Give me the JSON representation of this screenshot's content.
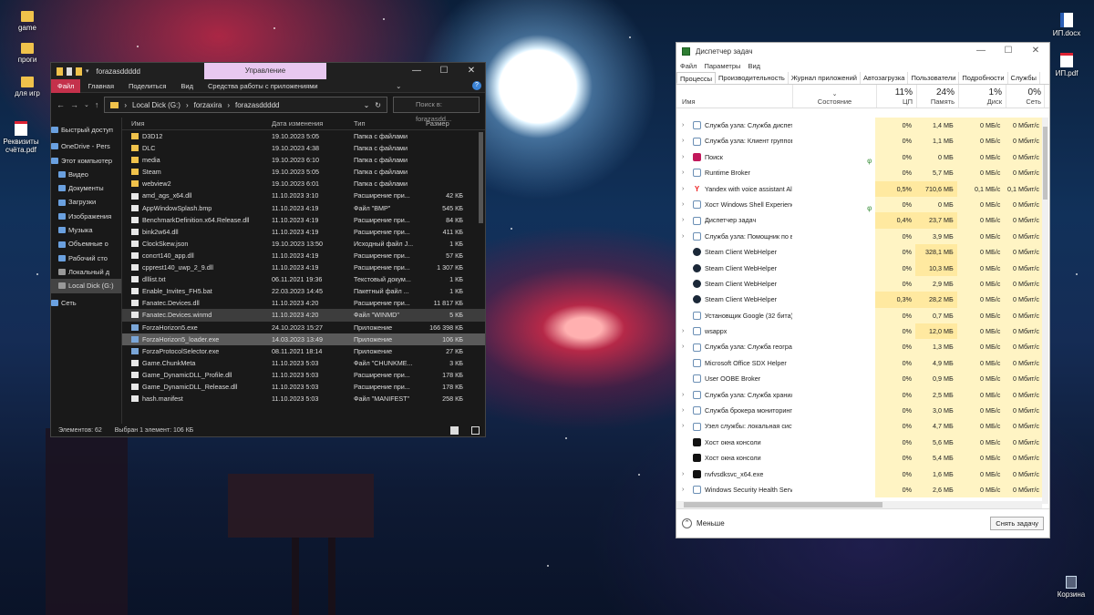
{
  "desktop": {
    "left_icons": [
      {
        "label": "game",
        "icon": "folder-icon"
      },
      {
        "label": "проги",
        "icon": "folder-icon"
      },
      {
        "label": "для игр",
        "icon": "folder-icon"
      },
      {
        "label": "Реквизиты счёта.pdf",
        "icon": "pdf-icon"
      }
    ],
    "right_icons": [
      {
        "label": "ИП.docx",
        "icon": "word-icon"
      },
      {
        "label": "ИП.pdf",
        "icon": "pdf-icon"
      }
    ],
    "recycle_bin": "Корзина"
  },
  "explorer": {
    "title": "forazasddddd",
    "context_tab": "Управление",
    "ribbon": [
      "Файл",
      "Главная",
      "Поделиться",
      "Вид",
      "Средства работы с приложениями"
    ],
    "path": [
      "Local Dick (G:)",
      "forzaxira",
      "forazasddddd"
    ],
    "search_placeholder": "Поиск в: forazasdd...",
    "sidebar": [
      "Быстрый доступ",
      "OneDrive - Pers",
      "Этот компьютер",
      "Видео",
      "Документы",
      "Загрузки",
      "Изображения",
      "Музыка",
      "Объемные о",
      "Рабочий сто",
      "Локальный д",
      "Local Dick (G:)",
      "Сеть"
    ],
    "columns": [
      "Имя",
      "Дата изменения",
      "Тип",
      "Размер"
    ],
    "files": [
      {
        "name": "D3D12",
        "date": "19.10.2023 5:05",
        "type": "Папка с файлами",
        "size": "",
        "kind": "folder"
      },
      {
        "name": "DLC",
        "date": "19.10.2023 4:38",
        "type": "Папка с файлами",
        "size": "",
        "kind": "folder"
      },
      {
        "name": "media",
        "date": "19.10.2023 6:10",
        "type": "Папка с файлами",
        "size": "",
        "kind": "folder"
      },
      {
        "name": "Steam",
        "date": "19.10.2023 5:05",
        "type": "Папка с файлами",
        "size": "",
        "kind": "folder"
      },
      {
        "name": "webview2",
        "date": "19.10.2023 6:01",
        "type": "Папка с файлами",
        "size": "",
        "kind": "folder"
      },
      {
        "name": "amd_ags_x64.dll",
        "date": "11.10.2023 3:10",
        "type": "Расширение при...",
        "size": "42 КБ",
        "kind": "file"
      },
      {
        "name": "AppWindowSplash.bmp",
        "date": "11.10.2023 4:19",
        "type": "Файл \"BMP\"",
        "size": "545 КБ",
        "kind": "file"
      },
      {
        "name": "BenchmarkDefinition.x64.Release.dll",
        "date": "11.10.2023 4:19",
        "type": "Расширение при...",
        "size": "84 КБ",
        "kind": "file"
      },
      {
        "name": "bink2w64.dll",
        "date": "11.10.2023 4:19",
        "type": "Расширение при...",
        "size": "411 КБ",
        "kind": "file"
      },
      {
        "name": "ClockSkew.json",
        "date": "19.10.2023 13:50",
        "type": "Исходный файл J...",
        "size": "1 КБ",
        "kind": "file"
      },
      {
        "name": "concrt140_app.dll",
        "date": "11.10.2023 4:19",
        "type": "Расширение при...",
        "size": "57 КБ",
        "kind": "file"
      },
      {
        "name": "cpprest140_uwp_2_9.dll",
        "date": "11.10.2023 4:19",
        "type": "Расширение при...",
        "size": "1 307 КБ",
        "kind": "file"
      },
      {
        "name": "dlllist.txt",
        "date": "06.11.2021 19:36",
        "type": "Текстовый докум...",
        "size": "1 КБ",
        "kind": "file"
      },
      {
        "name": "Enable_Invites_FH5.bat",
        "date": "22.03.2023 14:45",
        "type": "Пакетный файл ...",
        "size": "1 КБ",
        "kind": "file"
      },
      {
        "name": "Fanatec.Devices.dll",
        "date": "11.10.2023 4:20",
        "type": "Расширение при...",
        "size": "11 817 КБ",
        "kind": "file"
      },
      {
        "name": "Fanatec.Devices.winmd",
        "date": "11.10.2023 4:20",
        "type": "Файл \"WINMD\"",
        "size": "5 КБ",
        "kind": "file",
        "state": "hover"
      },
      {
        "name": "ForzaHorizon5.exe",
        "date": "24.10.2023 15:27",
        "type": "Приложение",
        "size": "166 398 КБ",
        "kind": "exe"
      },
      {
        "name": "ForzaHorizon5_loader.exe",
        "date": "14.03.2023 13:49",
        "type": "Приложение",
        "size": "106 КБ",
        "kind": "exe",
        "state": "selected"
      },
      {
        "name": "ForzaProtocolSelector.exe",
        "date": "08.11.2021 18:14",
        "type": "Приложение",
        "size": "27 КБ",
        "kind": "exe"
      },
      {
        "name": "Game.ChunkMeta",
        "date": "11.10.2023 5:03",
        "type": "Файл \"CHUNKME...",
        "size": "3 КБ",
        "kind": "file"
      },
      {
        "name": "Game_DynamicDLL_Profile.dll",
        "date": "11.10.2023 5:03",
        "type": "Расширение при...",
        "size": "178 КБ",
        "kind": "file"
      },
      {
        "name": "Game_DynamicDLL_Release.dll",
        "date": "11.10.2023 5:03",
        "type": "Расширение при...",
        "size": "178 КБ",
        "kind": "file"
      },
      {
        "name": "hash.manifest",
        "date": "11.10.2023 5:03",
        "type": "Файл \"MANIFEST\"",
        "size": "258 КБ",
        "kind": "file"
      }
    ],
    "status_count": "Элементов: 62",
    "status_selected": "Выбран 1 элемент: 106 КБ"
  },
  "taskmgr": {
    "title": "Диспетчер задач",
    "menu": [
      "Файл",
      "Параметры",
      "Вид"
    ],
    "tabs": [
      "Процессы",
      "Производительность",
      "Журнал приложений",
      "Автозагрузка",
      "Пользователи",
      "Подробности",
      "Службы"
    ],
    "columns": {
      "name": "Имя",
      "status": "Состояние",
      "cpu_pct": "11%",
      "cpu": "ЦП",
      "mem_pct": "24%",
      "mem": "Память",
      "disk_pct": "1%",
      "disk": "Диск",
      "net_pct": "0%",
      "net": "Сеть"
    },
    "processes": [
      {
        "name": "Служба узла: Служба диспетч...",
        "cpu": "0%",
        "mem": "1,4 МБ",
        "disk": "0 МБ/с",
        "net": "0 Мбит/с",
        "exp": true,
        "icon": "svc"
      },
      {
        "name": "Служба узла: Клиент группов...",
        "cpu": "0%",
        "mem": "1,1 МБ",
        "disk": "0 МБ/с",
        "net": "0 Мбит/с",
        "exp": true,
        "icon": "svc"
      },
      {
        "name": "Поиск",
        "cpu": "0%",
        "mem": "0 МБ",
        "disk": "0 МБ/с",
        "net": "0 Мбит/с",
        "exp": true,
        "icon": "red",
        "leaf": true
      },
      {
        "name": "Runtime Broker",
        "cpu": "0%",
        "mem": "5,7 МБ",
        "disk": "0 МБ/с",
        "net": "0 Мбит/с",
        "exp": true,
        "icon": "svc"
      },
      {
        "name": "Yandex with voice assistant Alic...",
        "cpu": "0,5%",
        "mem": "710,6 МБ",
        "disk": "0,1 МБ/с",
        "net": "0,1 Мбит/с",
        "exp": true,
        "icon": "y"
      },
      {
        "name": "Хост Windows Shell Experience",
        "cpu": "0%",
        "mem": "0 МБ",
        "disk": "0 МБ/с",
        "net": "0 Мбит/с",
        "exp": true,
        "icon": "svc",
        "leaf": true
      },
      {
        "name": "Диспетчер задач",
        "cpu": "0,4%",
        "mem": "23,7 МБ",
        "disk": "0 МБ/с",
        "net": "0 Мбит/с",
        "exp": true,
        "icon": "svc"
      },
      {
        "name": "Служба узла: Помощник по в...",
        "cpu": "0%",
        "mem": "3,9 МБ",
        "disk": "0 МБ/с",
        "net": "0 Мбит/с",
        "exp": true,
        "icon": "svc"
      },
      {
        "name": "Steam Client WebHelper",
        "cpu": "0%",
        "mem": "328,1 МБ",
        "disk": "0 МБ/с",
        "net": "0 Мбит/с",
        "exp": false,
        "icon": "steam"
      },
      {
        "name": "Steam Client WebHelper",
        "cpu": "0%",
        "mem": "10,3 МБ",
        "disk": "0 МБ/с",
        "net": "0 Мбит/с",
        "exp": false,
        "icon": "steam"
      },
      {
        "name": "Steam Client WebHelper",
        "cpu": "0%",
        "mem": "2,9 МБ",
        "disk": "0 МБ/с",
        "net": "0 Мбит/с",
        "exp": false,
        "icon": "steam"
      },
      {
        "name": "Steam Client WebHelper",
        "cpu": "0,3%",
        "mem": "28,2 МБ",
        "disk": "0 МБ/с",
        "net": "0 Мбит/с",
        "exp": false,
        "icon": "steam"
      },
      {
        "name": "Установщик Google (32 бита)",
        "cpu": "0%",
        "mem": "0,7 МБ",
        "disk": "0 МБ/с",
        "net": "0 Мбит/с",
        "exp": false,
        "icon": "svc"
      },
      {
        "name": "wsappx",
        "cpu": "0%",
        "mem": "12,0 МБ",
        "disk": "0 МБ/с",
        "net": "0 Мбит/с",
        "exp": true,
        "icon": "svc"
      },
      {
        "name": "Служба узла: Служба географ...",
        "cpu": "0%",
        "mem": "1,3 МБ",
        "disk": "0 МБ/с",
        "net": "0 Мбит/с",
        "exp": true,
        "icon": "svc"
      },
      {
        "name": "Microsoft Office SDX Helper",
        "cpu": "0%",
        "mem": "4,9 МБ",
        "disk": "0 МБ/с",
        "net": "0 Мбит/с",
        "exp": false,
        "icon": "svc"
      },
      {
        "name": "User OOBE Broker",
        "cpu": "0%",
        "mem": "0,9 МБ",
        "disk": "0 МБ/с",
        "net": "0 Мбит/с",
        "exp": false,
        "icon": "svc"
      },
      {
        "name": "Служба узла: Служба хранили...",
        "cpu": "0%",
        "mem": "2,5 МБ",
        "disk": "0 МБ/с",
        "net": "0 Мбит/с",
        "exp": true,
        "icon": "svc"
      },
      {
        "name": "Служба брокера мониторинга...",
        "cpu": "0%",
        "mem": "3,0 МБ",
        "disk": "0 МБ/с",
        "net": "0 Мбит/с",
        "exp": true,
        "icon": "svc"
      },
      {
        "name": "Узел службы: локальная систе...",
        "cpu": "0%",
        "mem": "4,7 МБ",
        "disk": "0 МБ/с",
        "net": "0 Мбит/с",
        "exp": true,
        "icon": "svc"
      },
      {
        "name": "Хост окна консоли",
        "cpu": "0%",
        "mem": "5,6 МБ",
        "disk": "0 МБ/с",
        "net": "0 Мбит/с",
        "exp": false,
        "icon": "bk"
      },
      {
        "name": "Хост окна консоли",
        "cpu": "0%",
        "mem": "5,4 МБ",
        "disk": "0 МБ/с",
        "net": "0 Мбит/с",
        "exp": false,
        "icon": "bk"
      },
      {
        "name": "nvfvsdksvc_x64.exe",
        "cpu": "0%",
        "mem": "1,6 МБ",
        "disk": "0 МБ/с",
        "net": "0 Мбит/с",
        "exp": true,
        "icon": "bk"
      },
      {
        "name": "Windows Security Health Service",
        "cpu": "0%",
        "mem": "2,6 МБ",
        "disk": "0 МБ/с",
        "net": "0 Мбит/с",
        "exp": true,
        "icon": "svc"
      }
    ],
    "fewer_details": "Меньше",
    "end_task": "Снять задачу"
  }
}
